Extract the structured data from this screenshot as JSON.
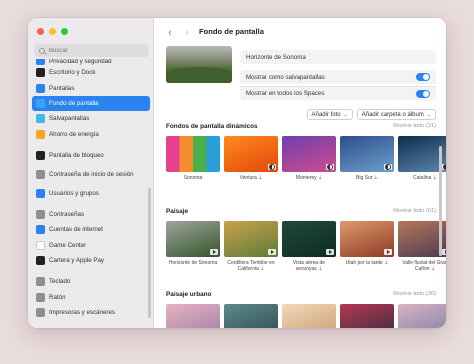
{
  "window": {
    "title": "Fondo de pantalla"
  },
  "search": {
    "placeholder": "Buscar"
  },
  "sidebar": {
    "items": [
      {
        "label": "Privacidad y seguridad",
        "color": "#2b82f1",
        "icon": "hand-icon",
        "cut": true
      },
      {
        "label": "Escritorio y Dock",
        "color": "#222222",
        "icon": "dock-icon"
      },
      {
        "label": "Pantallas",
        "color": "#2b82f1",
        "icon": "sun-icon"
      },
      {
        "label": "Fondo de pantalla",
        "color": "#36a6f0",
        "icon": "wallpaper-icon",
        "selected": true
      },
      {
        "label": "Salvapantallas",
        "color": "#41b9e8",
        "icon": "screensaver-icon"
      },
      {
        "label": "Ahorro de energía",
        "color": "#f4a81c",
        "icon": "battery-icon"
      },
      {
        "gap": true
      },
      {
        "label": "Pantalla de bloqueo",
        "color": "#222222",
        "icon": "lock-screen-icon"
      },
      {
        "label": "Contraseña de inicio de sesión",
        "color": "#8e8e93",
        "icon": "login-icon",
        "tall": true
      },
      {
        "label": "Usuarios y grupos",
        "color": "#2b82f1",
        "icon": "users-icon"
      },
      {
        "gap": true
      },
      {
        "label": "Contraseñas",
        "color": "#8e8e93",
        "icon": "key-icon"
      },
      {
        "label": "Cuentas de internet",
        "color": "#2b82f1",
        "icon": "at-icon"
      },
      {
        "label": "Game Center",
        "color": "#ffffff",
        "icon": "game-center-icon"
      },
      {
        "label": "Cartera y Apple Pay",
        "color": "#222222",
        "icon": "wallet-icon"
      },
      {
        "gap": true
      },
      {
        "label": "Teclado",
        "color": "#8e8e93",
        "icon": "keyboard-icon"
      },
      {
        "label": "Ratón",
        "color": "#8e8e93",
        "icon": "mouse-icon"
      },
      {
        "label": "Impresoras y escáneres",
        "color": "#8e8e93",
        "icon": "printer-icon"
      }
    ]
  },
  "current": {
    "name": "Horizonte de Sonoma",
    "screensaver_label": "Mostrar como salvapantallas",
    "screensaver_on": true,
    "all_spaces_label": "Mostrar en todos los Spaces",
    "all_spaces_on": true
  },
  "buttons": {
    "add_photo": "Añadir foto",
    "add_folder": "Añadir carpeta o álbum"
  },
  "sections": [
    {
      "title": "Fondos de pantalla dinámicos",
      "show_all": "Mostrar todo (31)",
      "tiles": [
        {
          "caption": "Sonoma",
          "colors": [
            "#e7428f",
            "#f58a2e",
            "#49b04c",
            "#2a9ed8"
          ],
          "badge": "none"
        },
        {
          "caption": "Ventura ⇣",
          "colors": [
            "#ff8a1e",
            "#e2480b"
          ],
          "badge": "dot"
        },
        {
          "caption": "Monterey ⇣",
          "colors": [
            "#6d3fb0",
            "#d04c8c"
          ],
          "badge": "dot"
        },
        {
          "caption": "Big Sur ⇣",
          "colors": [
            "#2d4d8c",
            "#6ea0c9"
          ],
          "badge": "dot"
        },
        {
          "caption": "Catalina ⇣",
          "colors": [
            "#0d2c4a",
            "#5f8bb0"
          ],
          "badge": "dot"
        }
      ]
    },
    {
      "title": "Paisaje",
      "show_all": "Mostrar todo (61)",
      "tiles": [
        {
          "caption": "Horizonte de Sonoma",
          "colors": [
            "#9ea69c",
            "#33542a"
          ],
          "badge": "play"
        },
        {
          "caption": "Cordillera Tembler en California ⇣",
          "colors": [
            "#c9a24a",
            "#5e7b3a"
          ],
          "badge": "play"
        },
        {
          "caption": "Vista aérea de secuoyas ⇣",
          "colors": [
            "#1f4a3a",
            "#0f2b20"
          ],
          "badge": "play"
        },
        {
          "caption": "Utah por la tarde ⇣",
          "colors": [
            "#e09a6a",
            "#8a3a26"
          ],
          "badge": "play"
        },
        {
          "caption": "Valle fluvial del Gran Cañón ⇣",
          "colors": [
            "#b5775a",
            "#4a3a50"
          ],
          "badge": "play"
        }
      ]
    },
    {
      "title": "Paisaje urbano",
      "show_all": "Mostrar todo (30)",
      "tiles": [
        {
          "caption": "",
          "colors": [
            "#e8b1c0",
            "#9a7fa8"
          ],
          "badge": "none"
        },
        {
          "caption": "",
          "colors": [
            "#5e8a88",
            "#2b4a52"
          ],
          "badge": "none"
        },
        {
          "caption": "",
          "colors": [
            "#f3d9b8",
            "#c99a74"
          ],
          "badge": "none"
        },
        {
          "caption": "",
          "colors": [
            "#b33a52",
            "#3a2a40"
          ],
          "badge": "none"
        },
        {
          "caption": "",
          "colors": [
            "#d9b4c0",
            "#7a7aa6"
          ],
          "badge": "none"
        }
      ]
    }
  ]
}
